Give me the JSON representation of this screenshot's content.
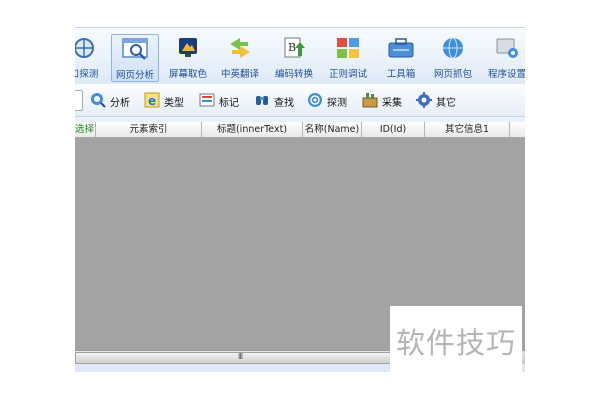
{
  "toolbar": {
    "items": [
      {
        "label": "口探测",
        "icon": "window-probe-icon"
      },
      {
        "label": "网页分析",
        "icon": "webpage-analysis-icon",
        "active": true
      },
      {
        "label": "屏幕取色",
        "icon": "screen-color-picker-icon"
      },
      {
        "label": "中英翻译",
        "icon": "translate-icon"
      },
      {
        "label": "编码转换",
        "icon": "encoding-convert-icon"
      },
      {
        "label": "正则调试",
        "icon": "regex-debug-icon"
      },
      {
        "label": "工具箱",
        "icon": "toolbox-icon"
      },
      {
        "label": "网页抓包",
        "icon": "packet-capture-icon"
      },
      {
        "label": "程序设置",
        "icon": "settings-icon"
      }
    ]
  },
  "subbar": {
    "items": [
      {
        "label": "分析",
        "icon": "analyze-icon"
      },
      {
        "label": "类型",
        "icon": "type-icon"
      },
      {
        "label": "标记",
        "icon": "mark-icon"
      },
      {
        "label": "查找",
        "icon": "find-icon"
      },
      {
        "label": "探测",
        "icon": "probe-icon"
      },
      {
        "label": "采集",
        "icon": "collect-icon"
      },
      {
        "label": "其它",
        "icon": "other-icon"
      }
    ]
  },
  "grid": {
    "columns": [
      "选择",
      "元素索引",
      "标题(innerText)",
      "名称(Name)",
      "ID(Id)",
      "其它信息1"
    ]
  },
  "scrollbar": {
    "grip": "III"
  },
  "watermark": {
    "text": "软件技巧"
  },
  "colors": {
    "accent": "#1f4fa0",
    "grid_body": "#a3a3a3",
    "first_column": "#1a8a1a"
  }
}
